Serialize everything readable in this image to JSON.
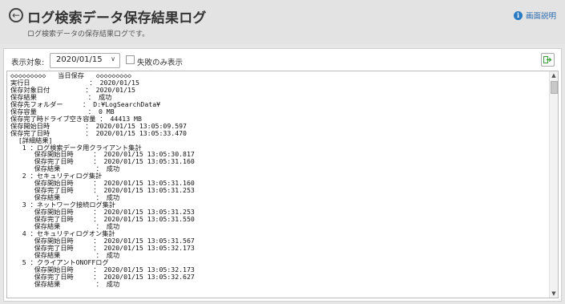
{
  "header": {
    "title": "ログ検索データ保存結果ログ",
    "subtitle": "ログ検索データの保存結果ログです。",
    "help_label": "画面説明",
    "help_icon": "info-icon"
  },
  "toolbar": {
    "filter_label": "表示対象:",
    "date_value": "2020/01/15",
    "fail_only_label": "失敗のみ表示",
    "export_icon": "export-icon"
  },
  "log": {
    "lines": [
      "◇◇◇◇◇◇◇◇◇   当日保存   ◇◇◇◇◇◇◇◇◇",
      "実行日               ： 2020/01/15",
      "保存対象日付         ： 2020/01/15",
      "保存結果             ： 成功",
      "保存先フォルダー     ： D:¥LogSearchData¥",
      "保存容量             ： 0 MB",
      "保存完了時ドライブ空き容量 ： 44413 MB",
      "保存開始日時         ： 2020/01/15 13:05:09.597",
      "保存完了日時         ： 2020/01/15 13:05:33.470",
      "  [詳細結果]",
      "   1 ：ログ検索データ用クライアント集計",
      "      保存開始日時     ： 2020/01/15 13:05:30.817",
      "      保存完了日時     ： 2020/01/15 13:05:31.160",
      "      保存結果         ： 成功",
      "   2 ：セキュリティログ集計",
      "      保存開始日時     ： 2020/01/15 13:05:31.160",
      "      保存完了日時     ： 2020/01/15 13:05:31.253",
      "      保存結果         ： 成功",
      "   3 ：ネットワーク接続ログ集計",
      "      保存開始日時     ： 2020/01/15 13:05:31.253",
      "      保存完了日時     ： 2020/01/15 13:05:31.550",
      "      保存結果         ： 成功",
      "   4 ：セキュリティログオン集計",
      "      保存開始日時     ： 2020/01/15 13:05:31.567",
      "      保存完了日時     ： 2020/01/15 13:05:32.173",
      "      保存結果         ： 成功",
      "   5 ：クライアントONOFFログ",
      "      保存開始日時     ： 2020/01/15 13:05:32.173",
      "      保存完了日時     ： 2020/01/15 13:05:32.627",
      "      保存結果         ： 成功"
    ]
  },
  "colors": {
    "header_bg": "#e3e3e3",
    "accent": "#2a7bc4",
    "export_green": "#3aa335"
  }
}
